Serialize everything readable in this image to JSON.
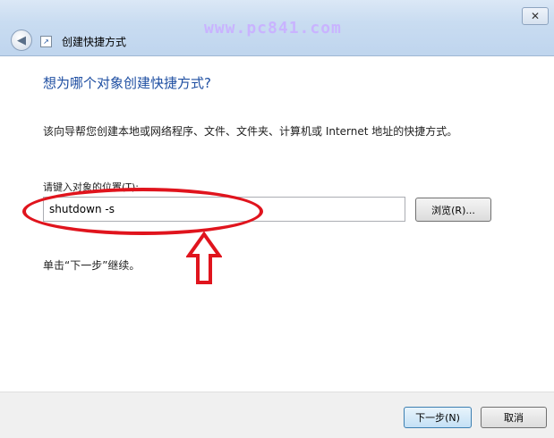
{
  "window": {
    "title": "创建快捷方式",
    "close_glyph": "✕",
    "back_glyph": "◀",
    "watermark": "www.pc841.com"
  },
  "main": {
    "heading": "想为哪个对象创建快捷方式?",
    "description": "该向导帮您创建本地或网络程序、文件、文件夹、计算机或 Internet 地址的快捷方式。",
    "location_label": "请键入对象的位置(T):",
    "location_value": "shutdown -s",
    "browse_label": "浏览(R)...",
    "hint": "单击“下一步”继续。"
  },
  "footer": {
    "next_label": "下一步(N)",
    "cancel_label": "取消"
  },
  "colors": {
    "heading": "#1f4fa2",
    "annotation": "#e0141d",
    "watermark": "#c9b3ff"
  },
  "icons": [
    "back-arrow-icon",
    "shortcut-icon",
    "close-icon",
    "up-arrow-annotation"
  ]
}
